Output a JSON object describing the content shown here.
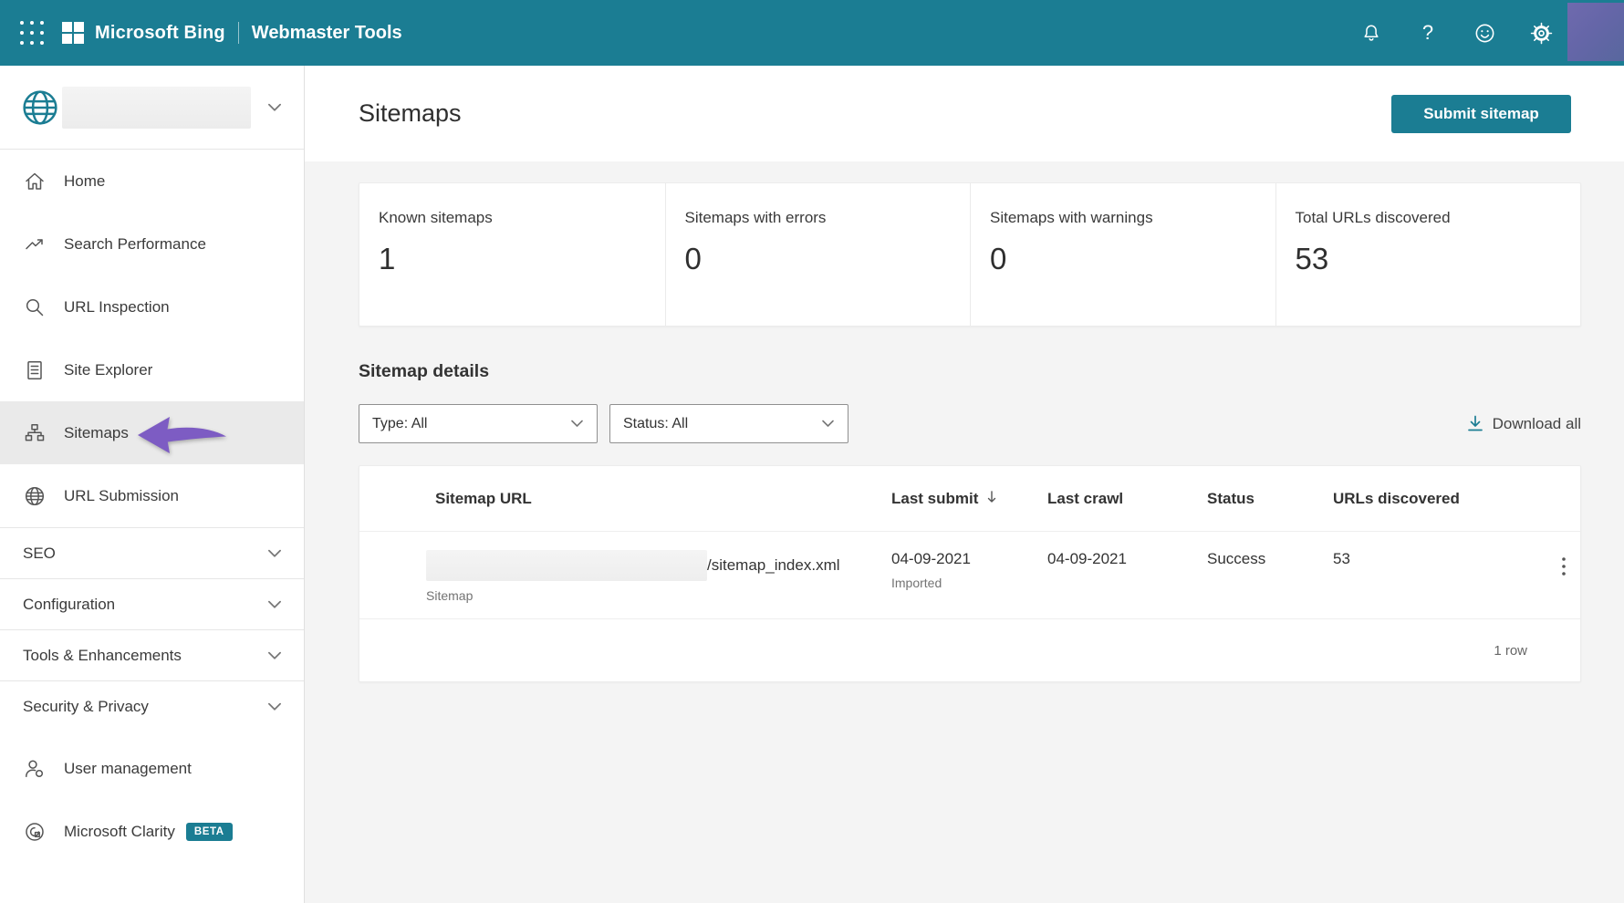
{
  "topbar": {
    "brand": "Microsoft Bing",
    "product": "Webmaster Tools",
    "icon_names": [
      "app-launcher",
      "microsoft-logo",
      "notifications",
      "help",
      "feedback",
      "settings",
      "user-avatar"
    ],
    "help_glyph": "?"
  },
  "sidebar": {
    "site_selector": {
      "icon": "globe",
      "site_name_blurred": ""
    },
    "items": [
      {
        "label": "Home",
        "icon": "home"
      },
      {
        "label": "Search Performance",
        "icon": "trend-up"
      },
      {
        "label": "URL Inspection",
        "icon": "magnifier"
      },
      {
        "label": "Site Explorer",
        "icon": "document-list"
      },
      {
        "label": "Sitemaps",
        "icon": "sitemap-tree"
      },
      {
        "label": "URL Submission",
        "icon": "globe-small"
      }
    ],
    "sections": [
      {
        "label": "SEO"
      },
      {
        "label": "Configuration"
      },
      {
        "label": "Tools & Enhancements"
      },
      {
        "label": "Security & Privacy"
      }
    ],
    "bottom_items": [
      {
        "label": "User management",
        "icon": "person"
      },
      {
        "label": "Microsoft Clarity",
        "icon": "clarity-swirl",
        "badge": "BETA"
      }
    ]
  },
  "page_header": {
    "title": "Sitemaps",
    "submit_button": "Submit sitemap"
  },
  "stats": {
    "cards": [
      {
        "label": "Known sitemaps",
        "value": "1"
      },
      {
        "label": "Sitemaps with errors",
        "value": "0"
      },
      {
        "label": "Sitemaps with warnings",
        "value": "0"
      },
      {
        "label": "Total URLs discovered",
        "value": "53"
      }
    ]
  },
  "sitemap_details": {
    "heading": "Sitemap details",
    "filters": {
      "type_label": "Type: All",
      "status_label": "Status: All"
    },
    "download_all_label": "Download all",
    "table": {
      "columns": [
        "Sitemap URL",
        "Last submit",
        "Last crawl",
        "Status",
        "URLs discovered"
      ],
      "row": {
        "url_suffix": "/sitemap_index.xml",
        "type_label": "Sitemap",
        "last_submit": "04-09-2021",
        "last_submit_note": "Imported",
        "last_crawl": "04-09-2021",
        "status": "Success",
        "urls_discovered": "53"
      },
      "footer": "1 row"
    }
  },
  "annotation": {
    "shape": "arrow-left",
    "points_to": "Sitemaps",
    "color": "#7d5cc3"
  },
  "colors": {
    "accent_teal": "#1b7d93",
    "content_bg": "#f4f4f4",
    "active_item_bg": "#eaeaea",
    "badge_teal": "#1b7d93",
    "arrow_purple": "#7d5cc3"
  }
}
